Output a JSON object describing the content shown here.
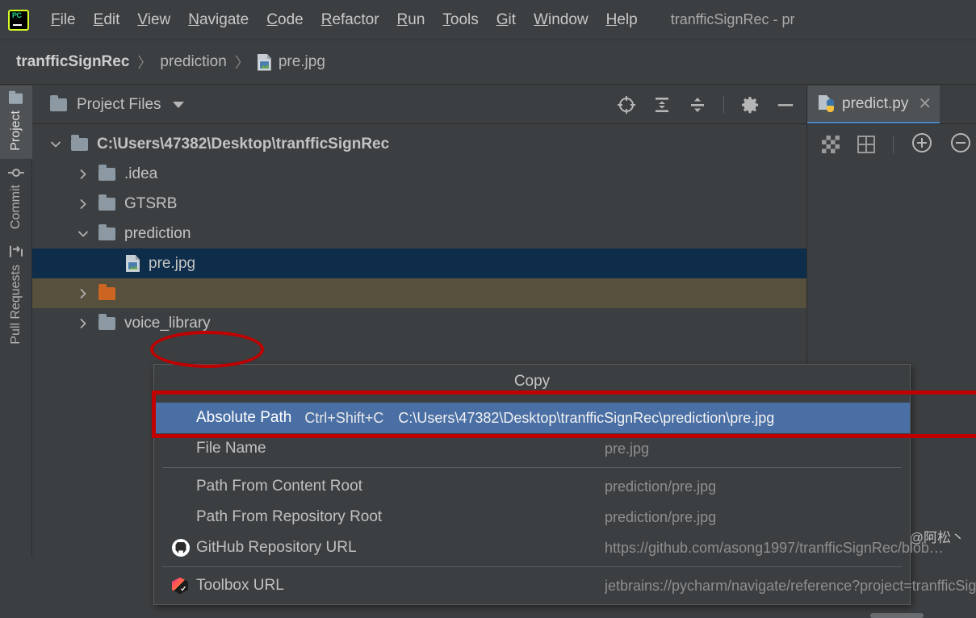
{
  "app": {
    "logo_label": "PC",
    "window_title": "tranfficSignRec - pr"
  },
  "menubar": {
    "items": [
      {
        "label": "File",
        "mnemonic": "F"
      },
      {
        "label": "Edit",
        "mnemonic": "E"
      },
      {
        "label": "View",
        "mnemonic": "V"
      },
      {
        "label": "Navigate",
        "mnemonic": "N"
      },
      {
        "label": "Code",
        "mnemonic": "C"
      },
      {
        "label": "Refactor",
        "mnemonic": "R"
      },
      {
        "label": "Run",
        "mnemonic": "R"
      },
      {
        "label": "Tools",
        "mnemonic": "T"
      },
      {
        "label": "Git",
        "mnemonic": "G"
      },
      {
        "label": "Window",
        "mnemonic": "W"
      },
      {
        "label": "Help",
        "mnemonic": "H"
      }
    ]
  },
  "breadcrumb": {
    "project": "tranfficSignRec",
    "folder": "prediction",
    "file": "pre.jpg",
    "separator": "〉",
    "file_icon": "image-file-icon"
  },
  "toolstrip": {
    "items": [
      {
        "label": "Project",
        "icon": "folder-icon",
        "active": true
      },
      {
        "label": "Commit",
        "icon": "commit-icon",
        "active": false
      },
      {
        "label": "Pull Requests",
        "icon": "pull-request-icon",
        "active": false
      }
    ]
  },
  "project_panel": {
    "title": "Project Files",
    "title_icon": "folder-icon",
    "dropdown_icon": "chevron-down-icon",
    "toolbar": [
      {
        "name": "select-opened-file-icon",
        "title": "Select Opened File"
      },
      {
        "name": "expand-all-icon",
        "title": "Expand All"
      },
      {
        "name": "collapse-all-icon",
        "title": "Collapse All"
      },
      {
        "name": "settings-gear-icon",
        "title": "Options"
      },
      {
        "name": "hide-minus-icon",
        "title": "Hide"
      }
    ],
    "tree": [
      {
        "label": "C:\\Users\\47382\\Desktop\\tranfficSignRec",
        "indent": 0,
        "arrow": "down",
        "icon": "folder-icon",
        "bold": true,
        "selected": false,
        "excluded": false
      },
      {
        "label": ".idea",
        "indent": 1,
        "arrow": "right",
        "icon": "folder-icon",
        "bold": false,
        "selected": false,
        "excluded": false
      },
      {
        "label": "GTSRB",
        "indent": 1,
        "arrow": "right",
        "icon": "folder-icon",
        "bold": false,
        "selected": false,
        "excluded": false
      },
      {
        "label": "prediction",
        "indent": 1,
        "arrow": "down",
        "icon": "folder-icon",
        "bold": false,
        "selected": false,
        "excluded": false
      },
      {
        "label": "pre.jpg",
        "indent": 2,
        "arrow": "none",
        "icon": "image-file-icon",
        "bold": false,
        "selected": true,
        "excluded": false
      },
      {
        "label": "",
        "indent": 1,
        "arrow": "right",
        "icon": "folder-icon-orange",
        "bold": false,
        "selected": false,
        "excluded": true
      },
      {
        "label": "voice_library",
        "indent": 1,
        "arrow": "right",
        "icon": "folder-icon",
        "bold": false,
        "selected": false,
        "excluded": false
      }
    ]
  },
  "context_menu": {
    "header": "Copy",
    "rows": [
      {
        "label": "Absolute Path",
        "shortcut": "Ctrl+Shift+C",
        "value": "C:\\Users\\47382\\Desktop\\tranfficSignRec\\prediction\\pre.jpg",
        "icon": "",
        "selected": true,
        "sep_after": false
      },
      {
        "label": "File Name",
        "shortcut": "",
        "value": "pre.jpg",
        "icon": "",
        "selected": false,
        "sep_after": true
      },
      {
        "label": "Path From Content Root",
        "shortcut": "",
        "value": "prediction/pre.jpg",
        "icon": "",
        "selected": false,
        "sep_after": false
      },
      {
        "label": "Path From Repository Root",
        "shortcut": "",
        "value": "prediction/pre.jpg",
        "icon": "",
        "selected": false,
        "sep_after": false
      },
      {
        "label": "GitHub Repository URL",
        "shortcut": "",
        "value": "https://github.com/asong1997/tranfficSignRec/blob…",
        "icon": "github-icon",
        "selected": false,
        "sep_after": true
      },
      {
        "label": "Toolbox URL",
        "shortcut": "",
        "value": "jetbrains://pycharm/navigate/reference?project=tranfficSignRe…",
        "icon": "jetbrains-toolbox-icon",
        "selected": false,
        "sep_after": false
      }
    ]
  },
  "editor": {
    "tab": {
      "label": "predict.py",
      "icon": "python-file-icon",
      "close_icon": "close-icon"
    },
    "toolbar": [
      {
        "name": "transparency-checker-icon",
        "title": "Toggle transparency chessboard"
      },
      {
        "name": "grid-icon",
        "title": "Toggle grid"
      },
      {
        "name": "zoom-in-icon",
        "title": "Zoom In"
      },
      {
        "name": "zoom-out-icon",
        "title": "Zoom Out"
      }
    ]
  },
  "annotations": {
    "ellipse_color": "#c00000",
    "rect_color": "#c00000"
  },
  "watermark": "CSDN @阿松丶",
  "colors": {
    "background": "#3c3f41",
    "selection_tree": "#0d2d4a",
    "selection_menu": "#4a6fa5",
    "excluded_row": "#56503c",
    "accent": "#4a88c7"
  }
}
